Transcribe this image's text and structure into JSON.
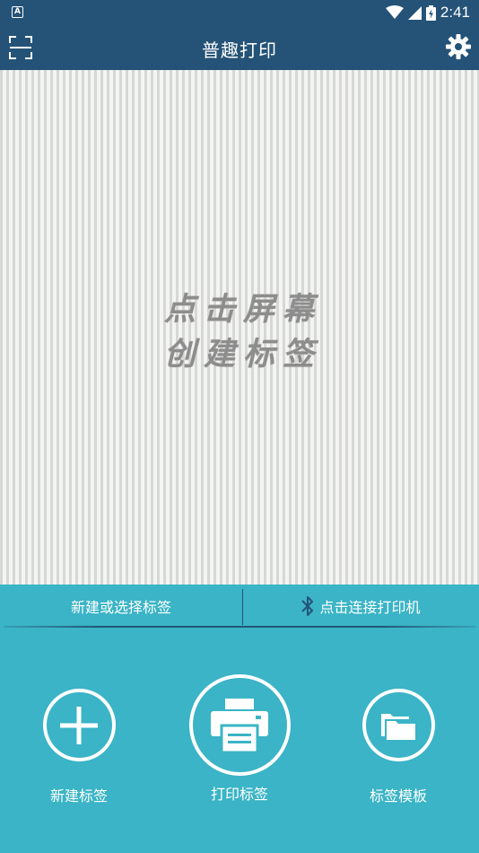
{
  "status": {
    "app_badge": "A",
    "time": "2:41"
  },
  "appbar": {
    "title": "普趣打印"
  },
  "canvas": {
    "hint_line1": "点击屏幕",
    "hint_line2": "创建标签"
  },
  "bar": {
    "new_or_select": "新建或选择标签",
    "connect_printer": "点击连接打印机"
  },
  "actions": [
    {
      "label": "新建标签"
    },
    {
      "label": "打印标签"
    },
    {
      "label": "标签模板"
    }
  ],
  "colors": {
    "header": "#245377",
    "accent": "#3ab4c6",
    "canvas_bg": "#f4f5f3",
    "stripe": "#d6d8d5",
    "hint_text": "#8d8d8d"
  }
}
